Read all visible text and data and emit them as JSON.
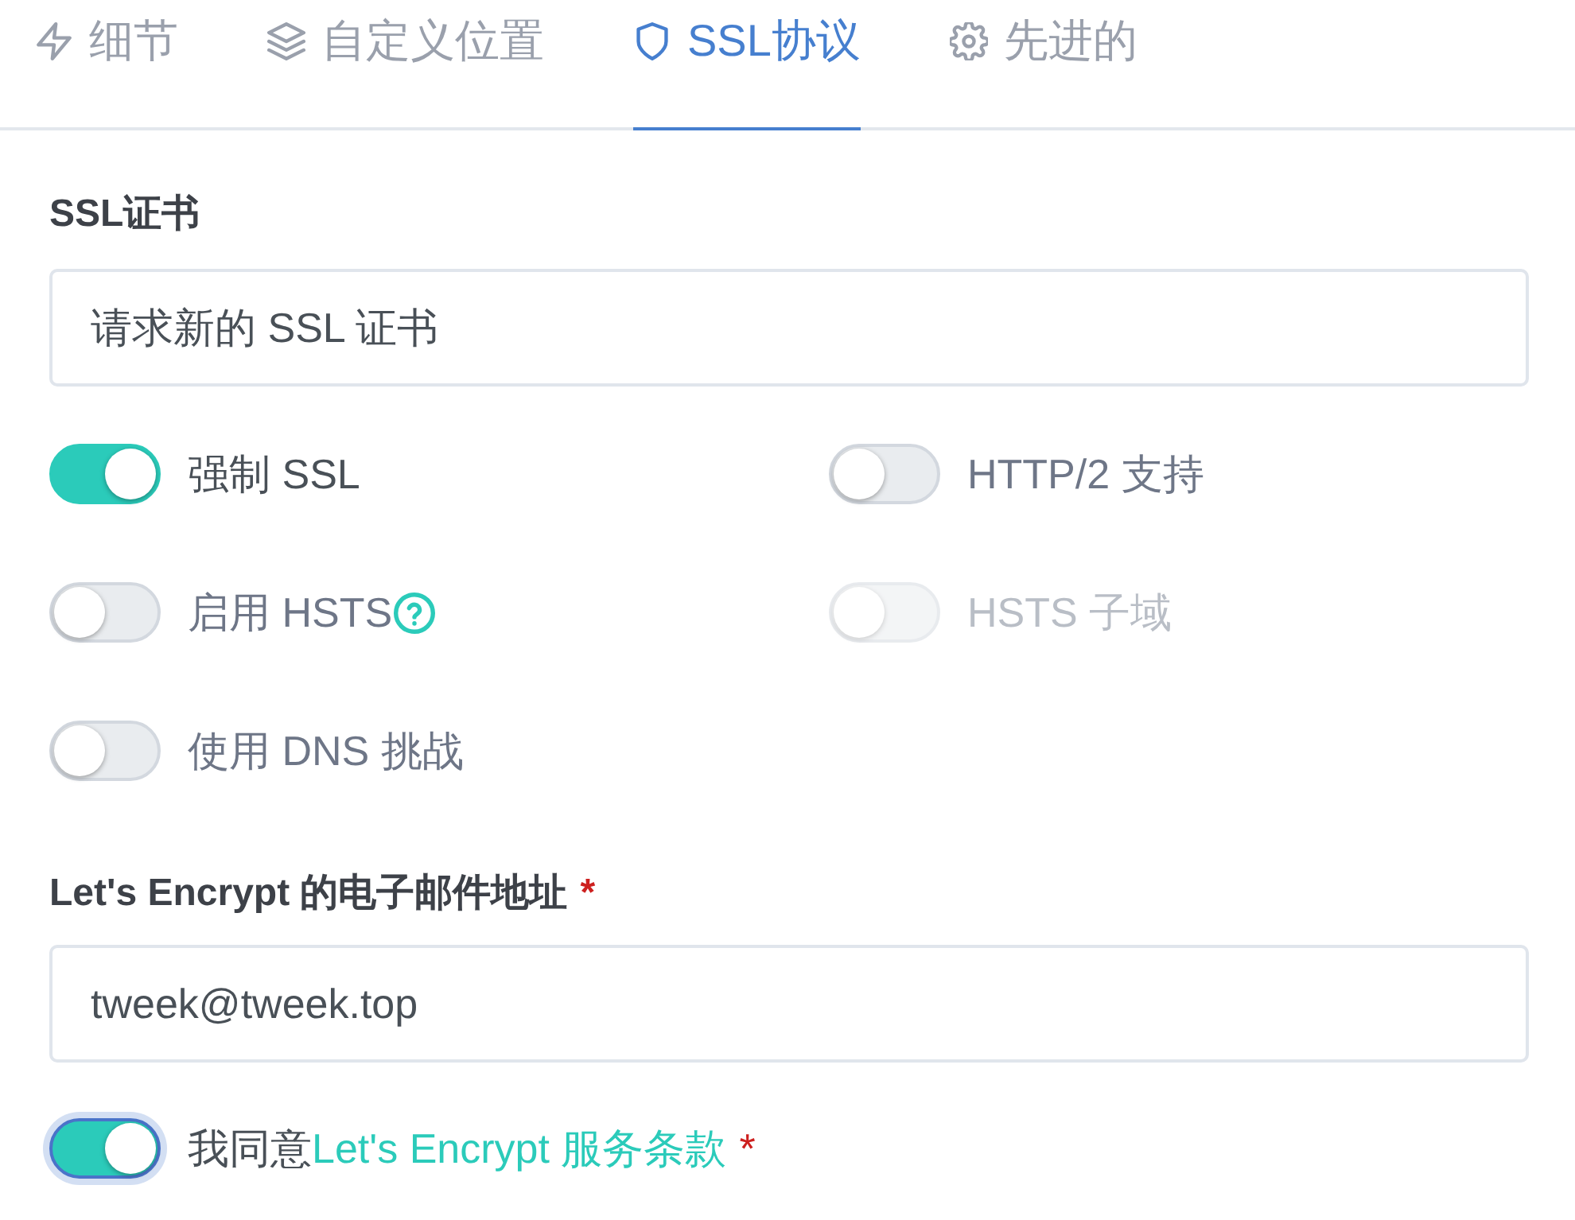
{
  "tabs": [
    {
      "label": "细节",
      "selected": false
    },
    {
      "label": "自定义位置",
      "selected": false
    },
    {
      "label": "SSL协议",
      "selected": true
    },
    {
      "label": "先进的",
      "selected": false
    }
  ],
  "ssl_certificate": {
    "label": "SSL证书",
    "value": "请求新的 SSL 证书"
  },
  "switches": [
    {
      "label": "强制 SSL",
      "on": true,
      "disabled": false,
      "help": false
    },
    {
      "label": "HTTP/2 支持",
      "on": false,
      "disabled": false,
      "help": false
    },
    {
      "label": "启用 HSTS",
      "on": false,
      "disabled": false,
      "help": true
    },
    {
      "label": "HSTS 子域",
      "on": false,
      "disabled": true,
      "help": false
    },
    {
      "label": "使用 DNS 挑战",
      "on": false,
      "disabled": false,
      "help": false
    }
  ],
  "email": {
    "label": "Let's Encrypt 的电子邮件地址",
    "required_mark": "*",
    "value": "tweek@tweek.top"
  },
  "agreement": {
    "text": "我同意",
    "link": "Let's Encrypt 服务条款",
    "required_mark": "*",
    "on": true,
    "focused": true
  }
}
